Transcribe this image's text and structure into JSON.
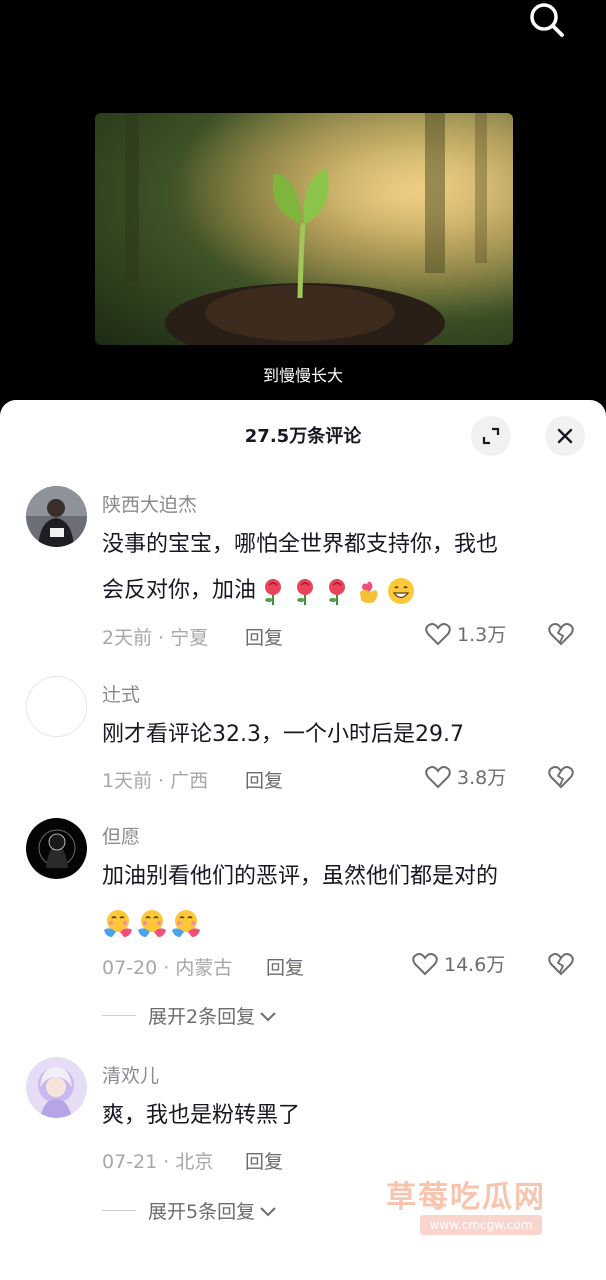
{
  "video": {
    "subtitle": "到慢慢长大"
  },
  "toolbar": {
    "search_icon": "search-icon"
  },
  "sheet": {
    "title": "27.5万条评论",
    "expand_icon": "expand-icon",
    "close_icon": "close-icon"
  },
  "comments": [
    {
      "username": "陕西大迫杰",
      "text_line1": "没事的宝宝，哪怕全世界都支持你，我也",
      "text_line2": "会反对你，加油",
      "emojis": [
        "rose",
        "rose",
        "rose",
        "hand-heart",
        "grin"
      ],
      "time": "2天前",
      "location": "宁夏",
      "reply_label": "回复",
      "likes": "1.3万"
    },
    {
      "username": "辻式",
      "text_line1": "刚才看评论32.3，一个小时后是29.7",
      "time": "1天前",
      "location": "广西",
      "reply_label": "回复",
      "likes": "3.8万"
    },
    {
      "username": "但愿",
      "text_line1": "加油别看他们的恶评，虽然他们都是对的",
      "emojis": [
        "hug",
        "hug",
        "hug"
      ],
      "time": "07-20",
      "location": "内蒙古",
      "reply_label": "回复",
      "likes": "14.6万",
      "expand_label": "展开2条回复"
    },
    {
      "username": "清欢儿",
      "text_line1": "爽，我也是粉转黑了",
      "time": "07-21",
      "location": "北京",
      "reply_label": "回复",
      "expand_label": "展开5条回复"
    }
  ],
  "meta_separator": " · ",
  "watermark": {
    "title": "草莓吃瓜网",
    "url": "www.cmcgw.com"
  }
}
